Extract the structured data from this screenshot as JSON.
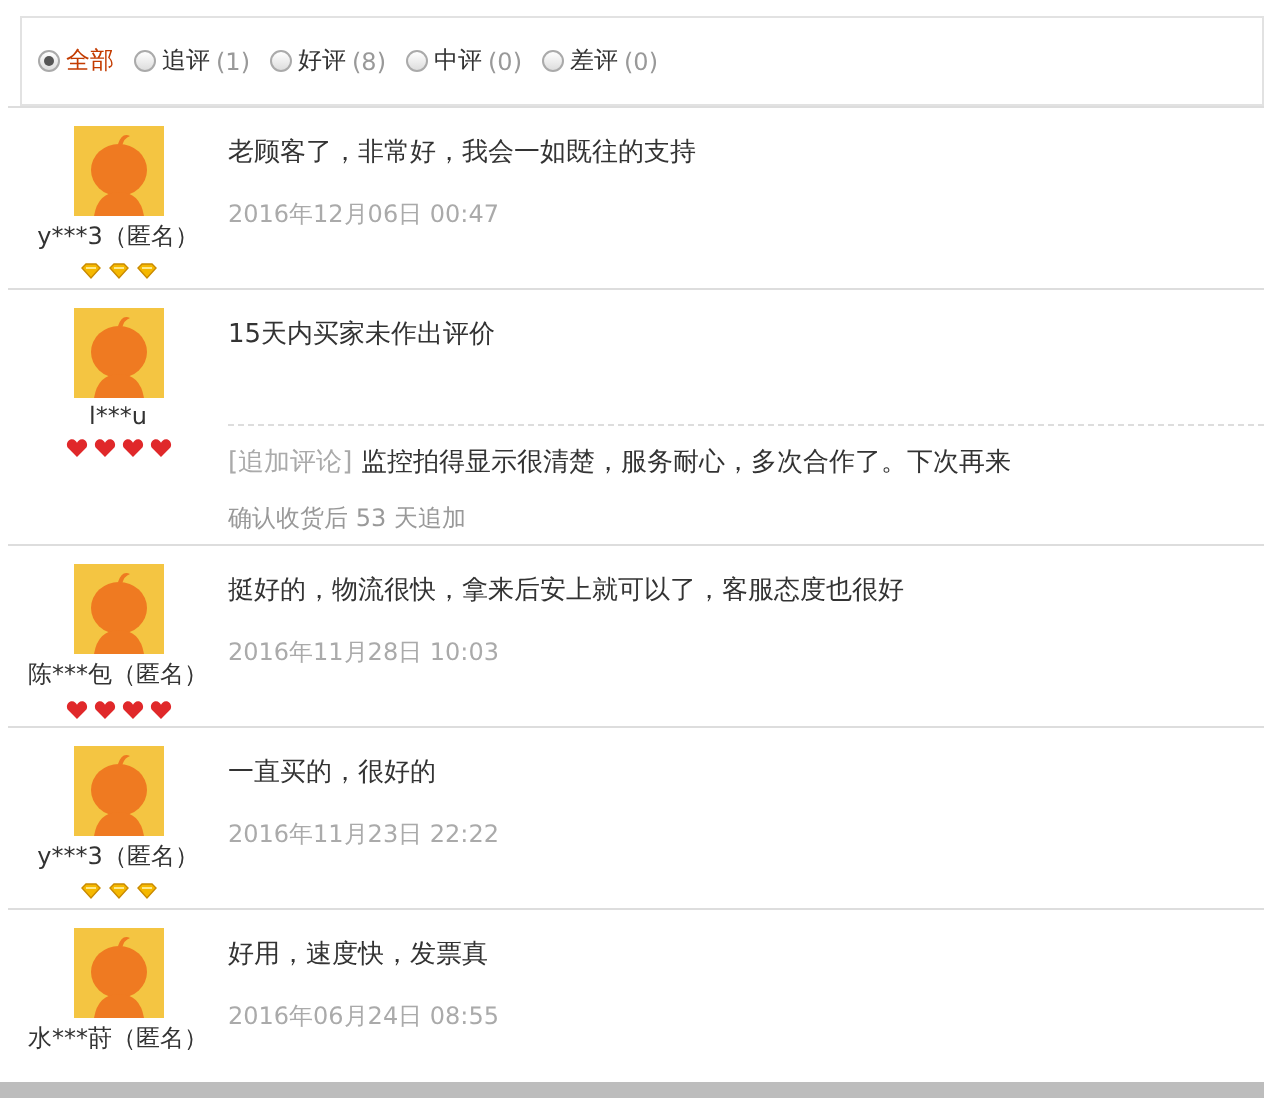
{
  "filters": [
    {
      "label": "全部",
      "selected": true
    },
    {
      "label": "追评",
      "count": "(1)",
      "selected": false
    },
    {
      "label": "好评",
      "count": "(8)",
      "selected": false
    },
    {
      "label": "中评",
      "count": "(0)",
      "selected": false
    },
    {
      "label": "差评",
      "count": "(0)",
      "selected": false
    }
  ],
  "reviews": [
    {
      "user": "y***3（匿名）",
      "rank": {
        "kind": "diamond",
        "stars": 3
      },
      "text": "老顾客了，非常好，我会一如既往的支持",
      "date": "2016年12月06日 00:47"
    },
    {
      "user": "l***u",
      "rank": {
        "kind": "heart",
        "stars": 4
      },
      "text": "15天内买家未作出评价",
      "followup": {
        "tag": "[追加评论]",
        "text": "监控拍得显示很清楚，服务耐心，多次合作了。下次再来",
        "note": "确认收货后 53 天追加"
      }
    },
    {
      "user": "陈***包（匿名）",
      "rank": {
        "kind": "heart",
        "stars": 4
      },
      "text": "挺好的，物流很快，拿来后安上就可以了，客服态度也很好",
      "date": "2016年11月28日 10:03"
    },
    {
      "user": "y***3（匿名）",
      "rank": {
        "kind": "diamond",
        "stars": 3
      },
      "text": "一直买的，很好的",
      "date": "2016年11月23日 22:22"
    },
    {
      "user": "水***莳（匿名）",
      "text": "好用，速度快，发票真",
      "date": "2016年06月24日 08:55"
    }
  ]
}
